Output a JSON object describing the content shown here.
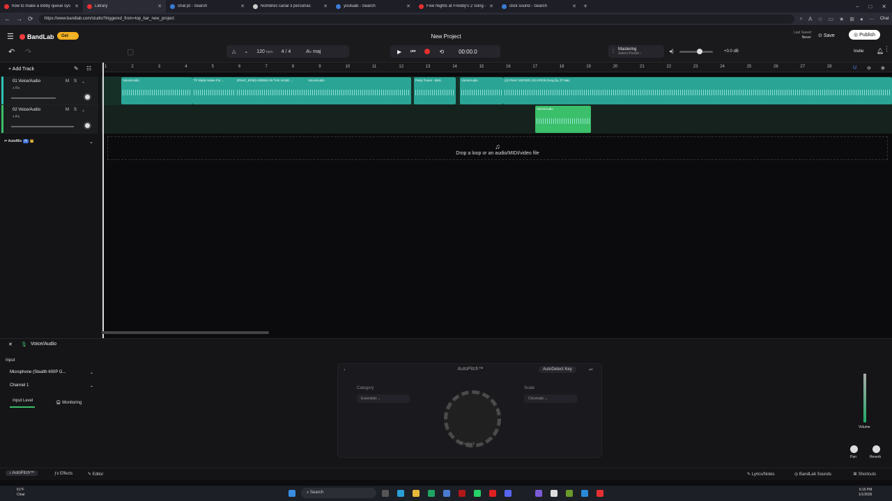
{
  "tabs": [
    {
      "title": "how to make a lobby queue sys",
      "color": "#e53030"
    },
    {
      "title": "Library",
      "color": "#e53030"
    },
    {
      "title": "chat pt - Search",
      "color": "#3a7bd5"
    },
    {
      "title": "Nombres canal 3 personas",
      "color": "#cccccc"
    },
    {
      "title": "youtuab - Search",
      "color": "#3a7bd5"
    },
    {
      "title": "Five Nights at Freddy's 2 Song - 'I",
      "color": "#e53030"
    },
    {
      "title": "click sound - Search",
      "color": "#3a7bd5"
    }
  ],
  "url": "https://www.bandlab.com/studio?triggered_from=top_bar_new_project",
  "chat_label": "Chat",
  "app": {
    "logo": "BandLab",
    "get": "Get 👑",
    "title": "New Project",
    "last_saved_label": "Last Saved",
    "last_saved_value": "Never",
    "save": "Save",
    "publish": "Publish",
    "invite": "Invite"
  },
  "transport": {
    "bpm_value": "120",
    "bpm_unit": "bpm",
    "time_sig": "4 / 4",
    "key": "A♭ maj",
    "time": "00:00.0"
  },
  "mastering": {
    "title": "Mastering",
    "preset": "Select Preset ›",
    "volume_db": "+0.0 dB",
    "volume_level": 0.6
  },
  "sidebar": {
    "add_track": "Add Track",
    "automix": "AutoMix",
    "tracks": [
      {
        "name": "01 Voice/Audio",
        "fx": "+ Fx",
        "color": "#2ec4b6"
      },
      {
        "name": "02 Voice/Audio",
        "fx": "+ Fx",
        "color": "#3cbf6a"
      }
    ]
  },
  "ruler": [
    "1",
    "2",
    "3",
    "4",
    "5",
    "6",
    "7",
    "8",
    "9",
    "10",
    "11",
    "12",
    "13",
    "14",
    "15",
    "16",
    "17",
    "18",
    "19",
    "20",
    "21",
    "22",
    "23",
    "24",
    "25",
    "26",
    "27",
    "28"
  ],
  "clips_track1": [
    {
      "title": "Voice/Audio"
    },
    {
      "title": "TF Static Noise For ..."
    },
    {
      "title": "(FNAF_EPM) HIDDEN IN THE SAND ..."
    },
    {
      "title": "Voice/Audio"
    },
    {
      "title": "Party Tunes - Bird..."
    },
    {
      "title": "Voice/Audio"
    },
    {
      "title": "(4) FNAF SISTER LOCATION Song by JT Mac"
    }
  ],
  "clips_track2": [
    {
      "title": "Voice/Audio"
    }
  ],
  "dropzone": "Drop a loop or an audio/MIDI/video file",
  "bottom": {
    "track": "Voice/Audio",
    "input_label": "Input",
    "input_device": "Microphone (Stealth 600P G...",
    "channel": "Channel 1",
    "input_level": "Input Level",
    "monitoring": "Monitoring"
  },
  "autopitch": {
    "title": "AutoPitch™",
    "autodetect": "AutoDetect Key",
    "category_label": "Category",
    "category_value": "Essentials",
    "scale_label": "Scale",
    "scale_value": "Chromatic",
    "knob_label": "Playback"
  },
  "mixer": {
    "volume": "Volume",
    "pan": "Pan",
    "reverb": "Reverb"
  },
  "footer": {
    "autopitch": "AutoPitch™",
    "effects": "Effects",
    "editor": "Editor",
    "lyrics": "Lyrics/Notes",
    "sounds": "BandLab Sounds",
    "shortcuts": "Shortcuts"
  },
  "taskbar": {
    "search": "Search",
    "weather_temp": "61°F",
    "weather_desc": "Clear",
    "time": "6:15 PM",
    "date": "1/1/2026"
  },
  "colors": {
    "accent": "#f43c3c",
    "track1": "#2ec4b6",
    "track2": "#3cbf6a"
  }
}
